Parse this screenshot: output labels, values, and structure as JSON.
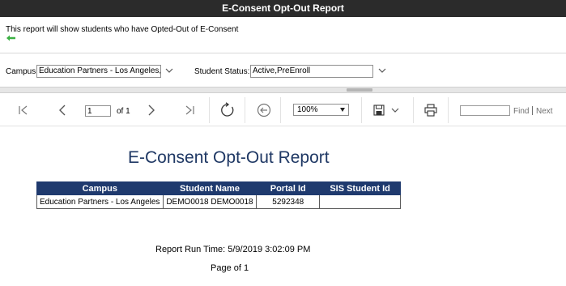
{
  "window": {
    "title": "E-Consent Opt-Out Report"
  },
  "description": "This report will show students who have Opted-Out of E-Consent",
  "params": {
    "campus_label": "Campus:",
    "campus_value": "Education Partners - Los Angeles,E",
    "status_label": "Student Status:",
    "status_value": "Active,PreEnroll"
  },
  "toolbar": {
    "page_number": "1",
    "of_pages": "of 1",
    "zoom": "100%",
    "find_label": "Find",
    "next_label": "Next"
  },
  "report": {
    "title": "E-Consent Opt-Out Report",
    "columns": [
      "Campus",
      "Student Name",
      "Portal Id",
      "SIS Student Id"
    ],
    "rows": [
      [
        "Education Partners - Los Angeles",
        "DEMO0018 DEMO0018",
        "5292348",
        ""
      ]
    ],
    "run_time": "Report Run Time: 5/9/2019 3:02:09 PM",
    "page_footer": "Page  of 1"
  },
  "colors": {
    "titlebar": "#2b2b2b",
    "header_bg": "#1f3a6e",
    "title_text": "#1f3864",
    "back_arrow": "#3cb043"
  },
  "icons": [
    "back-arrow-icon",
    "chevron-down-icon",
    "first-page-icon",
    "prev-page-icon",
    "next-page-icon",
    "last-page-icon",
    "refresh-icon",
    "back-icon",
    "save-icon",
    "print-icon"
  ]
}
